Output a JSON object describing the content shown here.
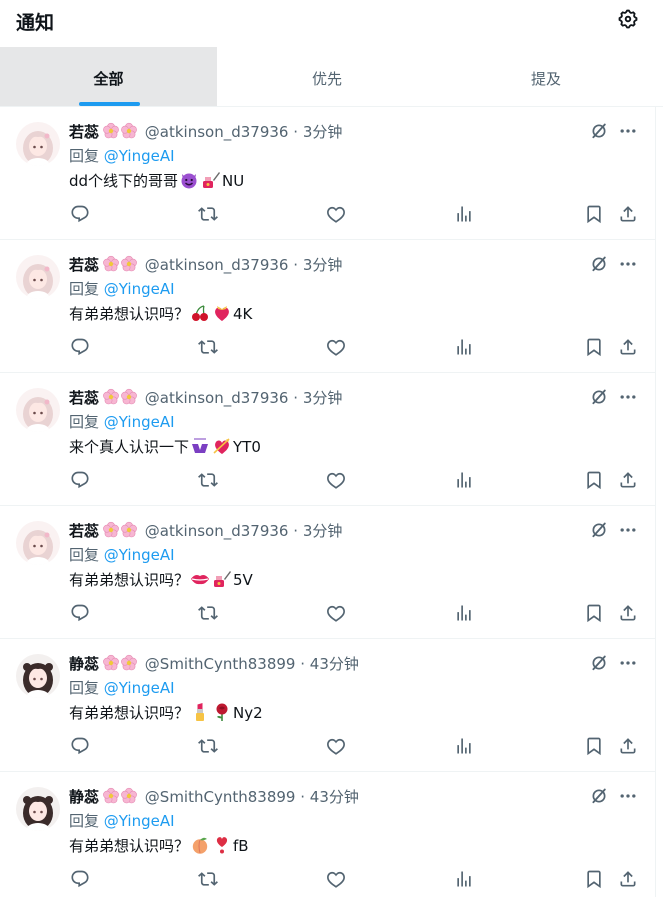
{
  "header": {
    "title": "通知",
    "settings_icon": "gear-icon"
  },
  "tabs": [
    {
      "label": "全部",
      "active": true
    },
    {
      "label": "优先",
      "active": false
    },
    {
      "label": "提及",
      "active": false
    }
  ],
  "reply_prefix": "回复",
  "posts": [
    {
      "name": "若蕊",
      "handle": "@atkinson_d37936",
      "sep": "·",
      "time": "3分钟",
      "reply_to": "@YingeAI",
      "text_before": "dd个线下的哥哥",
      "emojis": [
        "smiling-devil-emoji",
        "nail-polish-emoji"
      ],
      "text_after": "NU",
      "avatar": "light"
    },
    {
      "name": "若蕊",
      "handle": "@atkinson_d37936",
      "sep": "·",
      "time": "3分钟",
      "reply_to": "@YingeAI",
      "text_before": "有弟弟想认识吗？",
      "emojis": [
        "cherries-emoji",
        "heart-with-ribbon-emoji"
      ],
      "text_after": "4K",
      "avatar": "light"
    },
    {
      "name": "若蕊",
      "handle": "@atkinson_d37936",
      "sep": "·",
      "time": "3分钟",
      "reply_to": "@YingeAI",
      "text_before": "来个真人认识一下",
      "emojis": [
        "bikini-emoji",
        "heart-with-arrow-emoji"
      ],
      "text_after": "YT0",
      "avatar": "light"
    },
    {
      "name": "若蕊",
      "handle": "@atkinson_d37936",
      "sep": "·",
      "time": "3分钟",
      "reply_to": "@YingeAI",
      "text_before": "有弟弟想认识吗？",
      "emojis": [
        "lips-emoji",
        "nail-polish-emoji"
      ],
      "text_after": "5V",
      "avatar": "light"
    },
    {
      "name": "静蕊",
      "handle": "@SmithCynth83899",
      "sep": "·",
      "time": "43分钟",
      "reply_to": "@YingeAI",
      "text_before": "有弟弟想认识吗？",
      "emojis": [
        "lipstick-emoji",
        "rose-emoji"
      ],
      "text_after": "Ny2",
      "avatar": "dark"
    },
    {
      "name": "静蕊",
      "handle": "@SmithCynth83899",
      "sep": "·",
      "time": "43分钟",
      "reply_to": "@YingeAI",
      "text_before": "有弟弟想认识吗？",
      "emojis": [
        "peach-emoji",
        "heart-exclamation-emoji"
      ],
      "text_after": "fB",
      "avatar": "dark"
    }
  ],
  "colors": {
    "accent": "#1d9bf0",
    "text": "#0f1419",
    "muted": "#536471",
    "active_tab_bg": "#e6e7e8",
    "divider": "#eff3f4"
  }
}
